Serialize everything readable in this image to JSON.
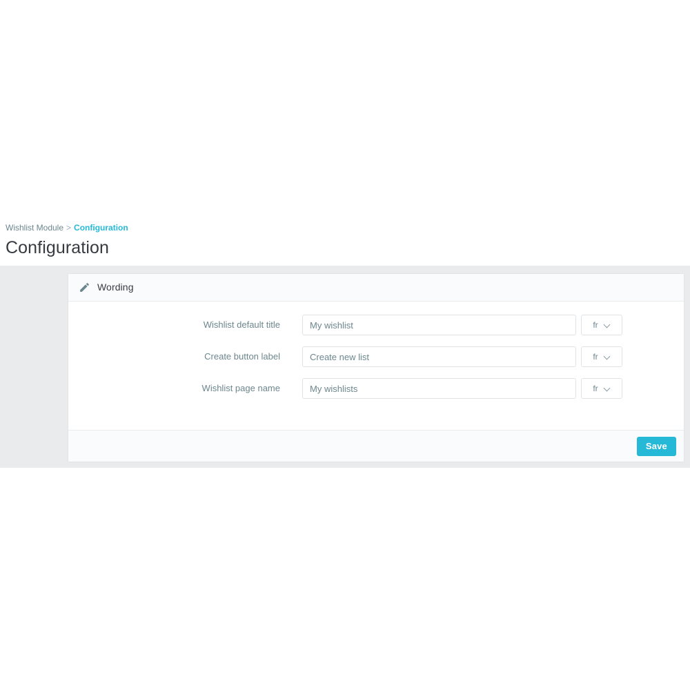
{
  "breadcrumb": {
    "root": "Wishlist Module",
    "separator": ">",
    "current": "Configuration"
  },
  "page": {
    "title": "Configuration"
  },
  "panel": {
    "icon": "pencil-icon",
    "heading": "Wording",
    "fields": [
      {
        "label": "Wishlist default title",
        "value": "My wishlist",
        "placeholder": "",
        "lang": "fr"
      },
      {
        "label": "Create button label",
        "value": "Create new list",
        "placeholder": "",
        "lang": "fr"
      },
      {
        "label": "Wishlist page name",
        "value": "My wishlists",
        "placeholder": "",
        "lang": "fr"
      }
    ],
    "footer": {
      "save_label": "Save"
    }
  },
  "colors": {
    "accent": "#25b9d7",
    "link": "#25b9d7",
    "page_background": "#ffffff",
    "content_background": "#eaebec",
    "panel_background": "#ffffff",
    "panel_header_background": "#fafbfc",
    "label_text": "#6c868e",
    "title_text": "#363a41"
  }
}
